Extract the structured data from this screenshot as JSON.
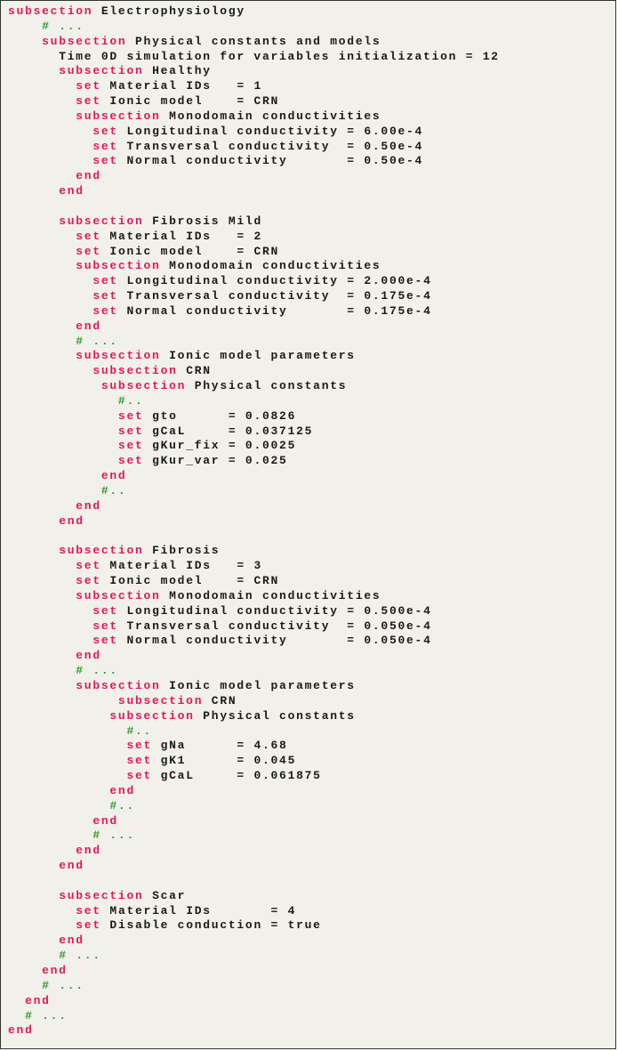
{
  "colors": {
    "keyword": "#e0195a",
    "comment": "#2e9a2e",
    "background": "#f2f0ea"
  },
  "lines": [
    {
      "pad": "",
      "kw": "subsection",
      "rest": " Electrophysiology"
    },
    {
      "pad": "    ",
      "cm": "# ..."
    },
    {
      "pad": "    ",
      "kw": "subsection",
      "rest": " Physical constants and models"
    },
    {
      "pad": "      ",
      "rest": "Time 0D simulation for variables initialization = 12"
    },
    {
      "pad": "      ",
      "kw": "subsection",
      "rest": " Healthy"
    },
    {
      "pad": "        ",
      "kw": "set",
      "rest": " Material IDs   = 1"
    },
    {
      "pad": "        ",
      "kw": "set",
      "rest": " Ionic model    = CRN"
    },
    {
      "pad": "        ",
      "kw": "subsection",
      "rest": " Monodomain conductivities"
    },
    {
      "pad": "          ",
      "kw": "set",
      "rest": " Longitudinal conductivity = 6.00e-4"
    },
    {
      "pad": "          ",
      "kw": "set",
      "rest": " Transversal conductivity  = 0.50e-4"
    },
    {
      "pad": "          ",
      "kw": "set",
      "rest": " Normal conductivity       = 0.50e-4"
    },
    {
      "pad": "        ",
      "kw": "end"
    },
    {
      "pad": "      ",
      "kw": "end"
    },
    {
      "pad": ""
    },
    {
      "pad": "      ",
      "kw": "subsection",
      "rest": " Fibrosis Mild"
    },
    {
      "pad": "        ",
      "kw": "set",
      "rest": " Material IDs   = 2"
    },
    {
      "pad": "        ",
      "kw": "set",
      "rest": " Ionic model    = CRN"
    },
    {
      "pad": "        ",
      "kw": "subsection",
      "rest": " Monodomain conductivities"
    },
    {
      "pad": "          ",
      "kw": "set",
      "rest": " Longitudinal conductivity = 2.000e-4"
    },
    {
      "pad": "          ",
      "kw": "set",
      "rest": " Transversal conductivity  = 0.175e-4"
    },
    {
      "pad": "          ",
      "kw": "set",
      "rest": " Normal conductivity       = 0.175e-4"
    },
    {
      "pad": "        ",
      "kw": "end"
    },
    {
      "pad": "        ",
      "cm": "# ..."
    },
    {
      "pad": "        ",
      "kw": "subsection",
      "rest": " Ionic model parameters"
    },
    {
      "pad": "          ",
      "kw": "subsection",
      "rest": " CRN"
    },
    {
      "pad": "           ",
      "kw": "subsection",
      "rest": " Physical constants"
    },
    {
      "pad": "             ",
      "cm": "#.."
    },
    {
      "pad": "             ",
      "kw": "set",
      "rest": " gto      = 0.0826"
    },
    {
      "pad": "             ",
      "kw": "set",
      "rest": " gCaL     = 0.037125"
    },
    {
      "pad": "             ",
      "kw": "set",
      "rest": " gKur_fix = 0.0025"
    },
    {
      "pad": "             ",
      "kw": "set",
      "rest": " gKur_var = 0.025"
    },
    {
      "pad": "           ",
      "kw": "end"
    },
    {
      "pad": "           ",
      "cm": "#.."
    },
    {
      "pad": "        ",
      "kw": "end"
    },
    {
      "pad": "      ",
      "kw": "end"
    },
    {
      "pad": ""
    },
    {
      "pad": "      ",
      "kw": "subsection",
      "rest": " Fibrosis"
    },
    {
      "pad": "        ",
      "kw": "set",
      "rest": " Material IDs   = 3"
    },
    {
      "pad": "        ",
      "kw": "set",
      "rest": " Ionic model    = CRN"
    },
    {
      "pad": "        ",
      "kw": "subsection",
      "rest": " Monodomain conductivities"
    },
    {
      "pad": "          ",
      "kw": "set",
      "rest": " Longitudinal conductivity = 0.500e-4"
    },
    {
      "pad": "          ",
      "kw": "set",
      "rest": " Transversal conductivity  = 0.050e-4"
    },
    {
      "pad": "          ",
      "kw": "set",
      "rest": " Normal conductivity       = 0.050e-4"
    },
    {
      "pad": "        ",
      "kw": "end"
    },
    {
      "pad": "        ",
      "cm": "# ..."
    },
    {
      "pad": "        ",
      "kw": "subsection",
      "rest": " Ionic model parameters"
    },
    {
      "pad": "             ",
      "kw": "subsection",
      "rest": " CRN"
    },
    {
      "pad": "            ",
      "kw": "subsection",
      "rest": " Physical constants"
    },
    {
      "pad": "              ",
      "cm": "#.."
    },
    {
      "pad": "              ",
      "kw": "set",
      "rest": " gNa      = 4.68"
    },
    {
      "pad": "              ",
      "kw": "set",
      "rest": " gK1      = 0.045"
    },
    {
      "pad": "              ",
      "kw": "set",
      "rest": " gCaL     = 0.061875"
    },
    {
      "pad": "            ",
      "kw": "end"
    },
    {
      "pad": "            ",
      "cm": "#.."
    },
    {
      "pad": "          ",
      "kw": "end"
    },
    {
      "pad": "          ",
      "cm": "# ..."
    },
    {
      "pad": "        ",
      "kw": "end"
    },
    {
      "pad": "      ",
      "kw": "end"
    },
    {
      "pad": ""
    },
    {
      "pad": "      ",
      "kw": "subsection",
      "rest": " Scar"
    },
    {
      "pad": "        ",
      "kw": "set",
      "rest": " Material IDs       = 4"
    },
    {
      "pad": "        ",
      "kw": "set",
      "rest": " Disable conduction = true"
    },
    {
      "pad": "      ",
      "kw": "end"
    },
    {
      "pad": "      ",
      "cm": "# ..."
    },
    {
      "pad": "    ",
      "kw": "end"
    },
    {
      "pad": "    ",
      "cm": "# ..."
    },
    {
      "pad": "  ",
      "kw": "end"
    },
    {
      "pad": "  ",
      "cm": "# ..."
    },
    {
      "pad": "",
      "kw": "end"
    }
  ]
}
